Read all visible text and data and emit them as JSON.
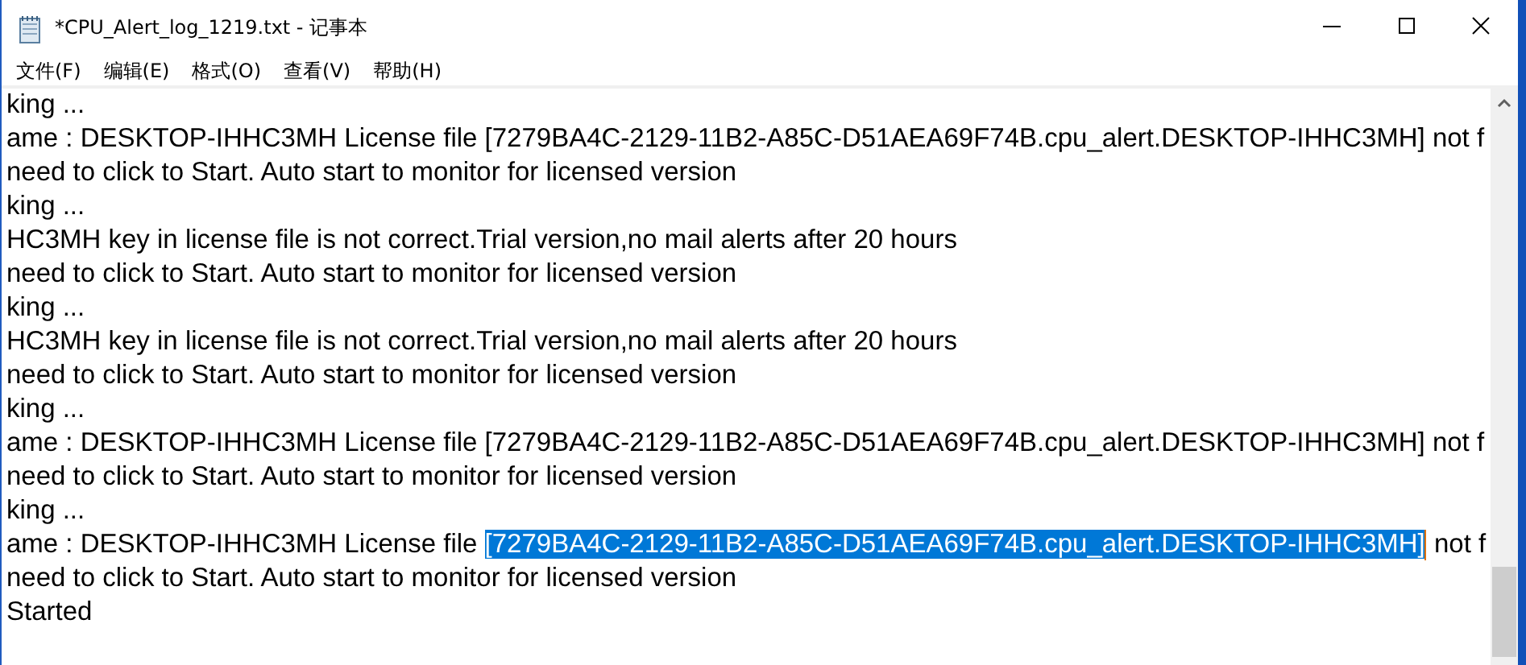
{
  "window": {
    "title": "*CPU_Alert_log_1219.txt - 记事本"
  },
  "menu": [
    "文件(F)",
    "编辑(E)",
    "格式(O)",
    "查看(V)",
    "帮助(H)"
  ],
  "lines": [
    {
      "segments": [
        {
          "text": "king ...",
          "selected": false
        }
      ]
    },
    {
      "segments": [
        {
          "text": "ame : DESKTOP-IHHC3MH License file [7279BA4C-2129-11B2-A85C-D51AEA69F74B.cpu_alert.DESKTOP-IHHC3MH] not f",
          "selected": false
        }
      ]
    },
    {
      "segments": [
        {
          "text": "need to click to Start. Auto start to monitor for licensed version",
          "selected": false
        }
      ]
    },
    {
      "segments": [
        {
          "text": "king ...",
          "selected": false
        }
      ]
    },
    {
      "segments": [
        {
          "text": "HC3MH key in license file is not correct.Trial version,no mail alerts after 20 hours",
          "selected": false
        }
      ]
    },
    {
      "segments": [
        {
          "text": "need to click to Start. Auto start to monitor for licensed version",
          "selected": false
        }
      ]
    },
    {
      "segments": [
        {
          "text": "king ...",
          "selected": false
        }
      ]
    },
    {
      "segments": [
        {
          "text": "HC3MH key in license file is not correct.Trial version,no mail alerts after 20 hours",
          "selected": false
        }
      ]
    },
    {
      "segments": [
        {
          "text": "need to click to Start. Auto start to monitor for licensed version",
          "selected": false
        }
      ]
    },
    {
      "segments": [
        {
          "text": "king ...",
          "selected": false
        }
      ]
    },
    {
      "segments": [
        {
          "text": "ame : DESKTOP-IHHC3MH License file [7279BA4C-2129-11B2-A85C-D51AEA69F74B.cpu_alert.DESKTOP-IHHC3MH] not f",
          "selected": false
        }
      ]
    },
    {
      "segments": [
        {
          "text": "need to click to Start. Auto start to monitor for licensed version",
          "selected": false
        }
      ]
    },
    {
      "segments": [
        {
          "text": "king ...",
          "selected": false
        }
      ]
    },
    {
      "segments": [
        {
          "text": "ame : DESKTOP-IHHC3MH License file ",
          "selected": false
        },
        {
          "text": "[7279BA4C-2129-11B2-A85C-D51AEA69F74B.cpu_alert.DESKTOP-IHHC3MH]",
          "selected": true
        },
        {
          "text": " not f",
          "selected": false
        }
      ]
    },
    {
      "segments": [
        {
          "text": "need to click to Start. Auto start to monitor for licensed version",
          "selected": false
        }
      ]
    },
    {
      "segments": [
        {
          "text": "Started",
          "selected": false
        }
      ]
    }
  ]
}
